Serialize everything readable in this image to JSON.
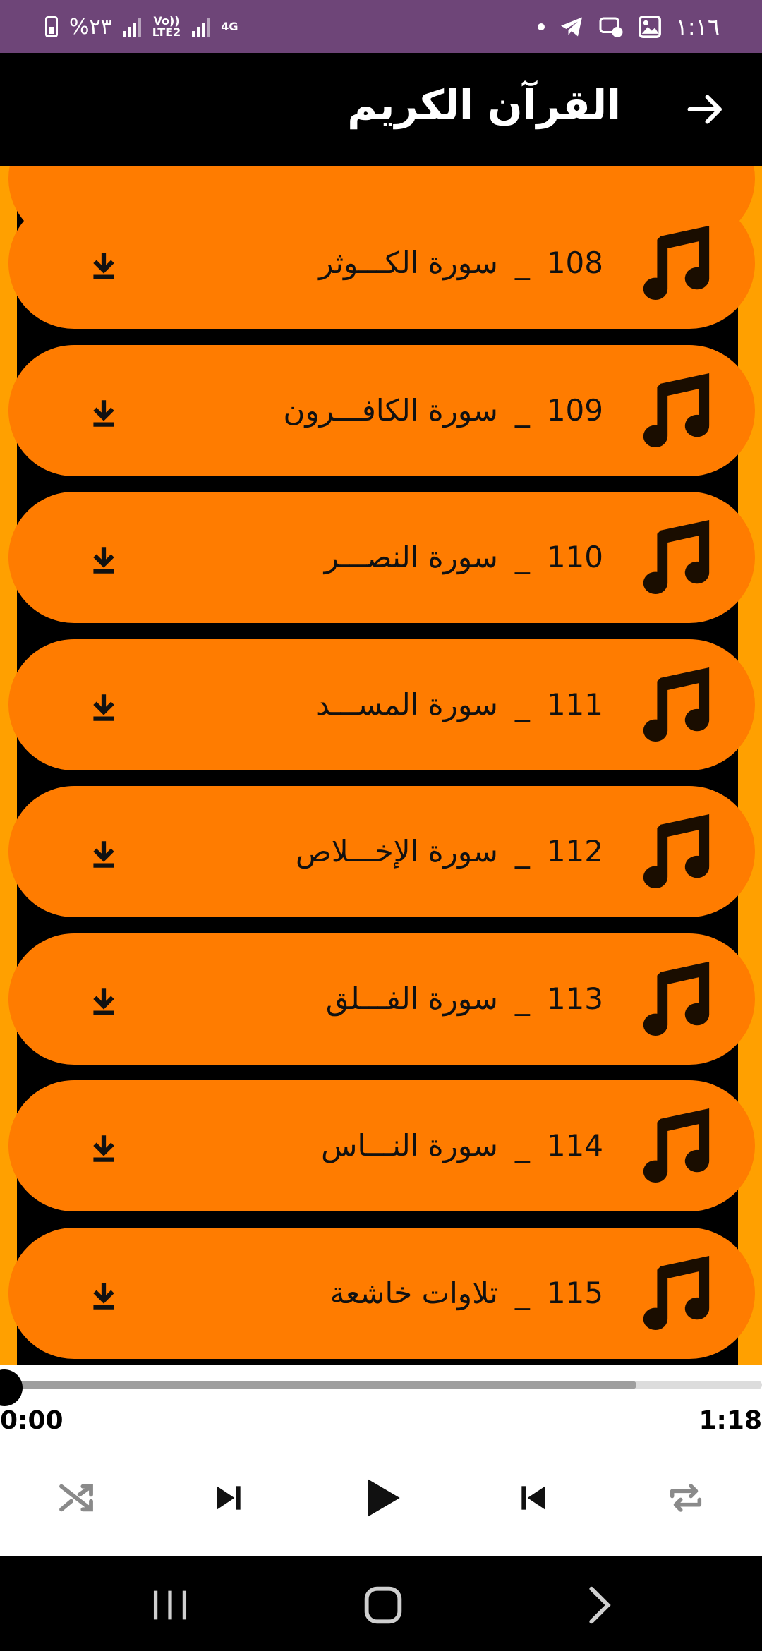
{
  "status_bar": {
    "time": "١:١٦",
    "battery": "%٢٣",
    "network_tag_1": "Vo))",
    "network_tag_2": "LTE2",
    "network_type": "4G"
  },
  "app_bar": {
    "title": "القرآن الكريم"
  },
  "items": [
    {
      "number": "108",
      "separator": "_",
      "name": "سورة الكـــوثر"
    },
    {
      "number": "109",
      "separator": "_",
      "name": "سورة الكافـــرون"
    },
    {
      "number": "110",
      "separator": "_",
      "name": "سورة النصـــر"
    },
    {
      "number": "111",
      "separator": "_",
      "name": "سورة المســـد"
    },
    {
      "number": "112",
      "separator": "_",
      "name": "سورة الإخـــلاص"
    },
    {
      "number": "113",
      "separator": "_",
      "name": "سورة الفـــلق"
    },
    {
      "number": "114",
      "separator": "_",
      "name": "سورة النـــاس"
    },
    {
      "number": "115",
      "separator": "_",
      "name": "تلاوات خاشعة"
    }
  ],
  "player": {
    "current_time": "0:00",
    "duration": "1:18",
    "progress_buffered": 0.835,
    "progress_played": 0.0
  },
  "colors": {
    "status_bar": "#6e4578",
    "item_bg": "#ff7c00",
    "stripe": "#ffa000"
  }
}
